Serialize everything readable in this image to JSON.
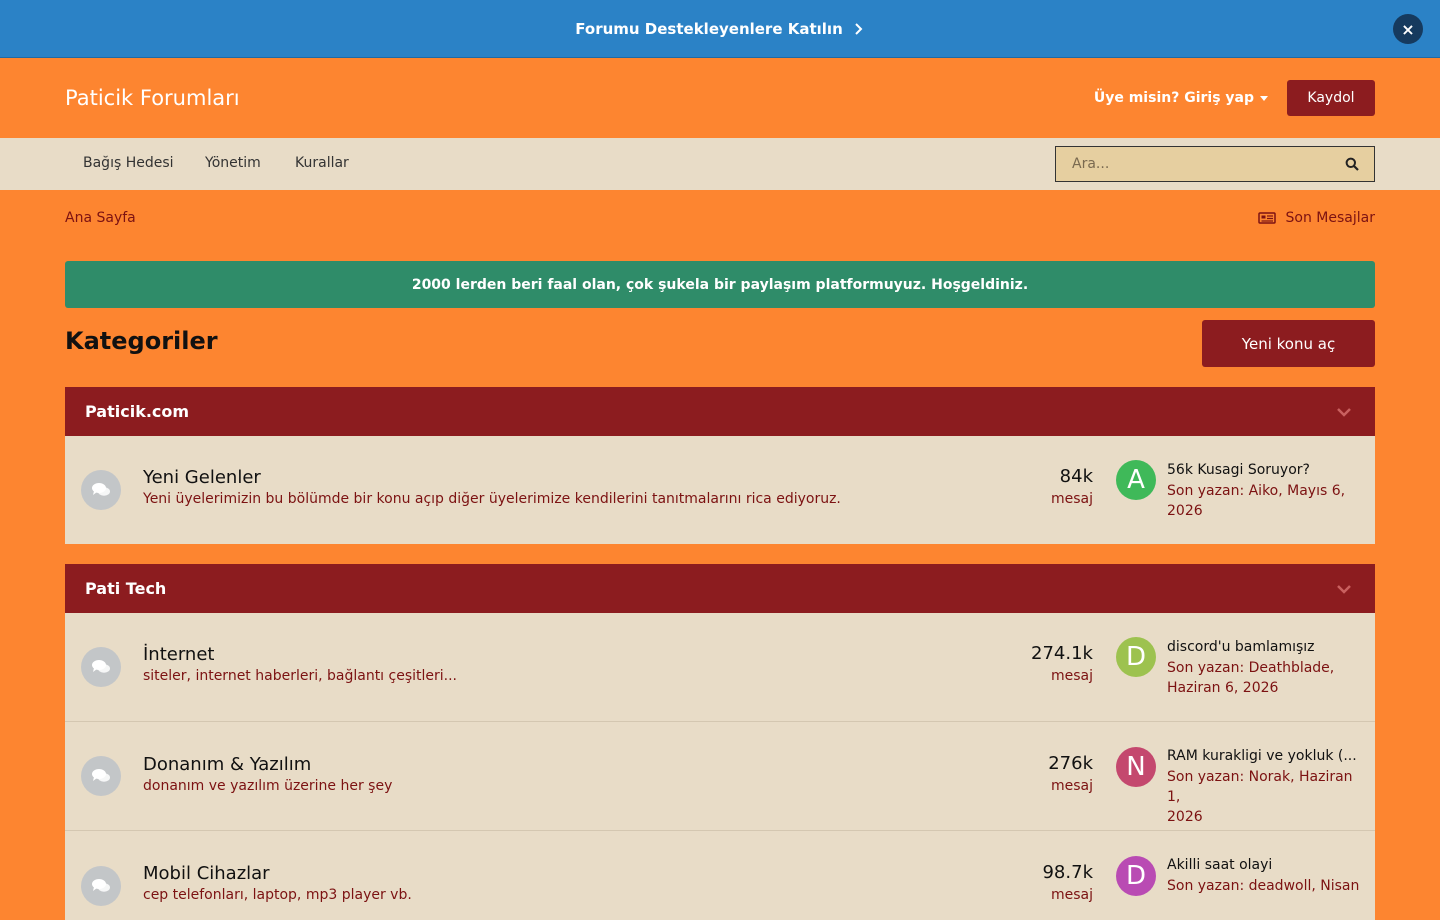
{
  "promo": {
    "text": "Forumu Destekleyenlere Katılın",
    "close": "×"
  },
  "header": {
    "site_title": "Paticik Forumları",
    "login": "Üye misin? Giriş yap",
    "register": "Kaydol"
  },
  "nav": {
    "items": [
      "Bağış Hedesi",
      "Yönetim",
      "Kurallar"
    ],
    "search_placeholder": "Ara..."
  },
  "breadcrumb": {
    "home": "Ana Sayfa",
    "recent": "Son Mesajlar"
  },
  "announcement": "2000 lerden beri faal olan, çok şukela bir paylaşım platformuyuz. Hoşgeldiniz.",
  "page": {
    "title": "Kategoriler",
    "new_topic": "Yeni konu aç"
  },
  "categories": [
    {
      "name": "Paticik.com",
      "forums": [
        {
          "title": "Yeni Gelenler",
          "desc": "Yeni üyelerimizin bu bölümde bir konu açıp diğer üyelerimize kendilerini tanıtmalarını rica ediyoruz.",
          "count": "84k",
          "count_label": "mesaj",
          "avatar": "A",
          "avatar_color": "#3fb959",
          "last_title": "56k Kusagi Soruyor?",
          "last_line1": "Son yazan: Aiko, Mayıs 6,",
          "last_line2": "2026"
        }
      ]
    },
    {
      "name": "Pati Tech",
      "forums": [
        {
          "title": "İnternet",
          "desc": "siteler, internet haberleri, bağlantı çeşitleri...",
          "count": "274.1k",
          "count_label": "mesaj",
          "avatar": "D",
          "avatar_color": "#9dc24f",
          "last_title": "discord'u bamlamışız",
          "last_line1": "Son yazan: Deathblade,",
          "last_line2": "Haziran 6, 2026"
        },
        {
          "title": "Donanım & Yazılım",
          "desc": "donanım ve yazılım üzerine her şey",
          "count": "276k",
          "count_label": "mesaj",
          "avatar": "N",
          "avatar_color": "#c4486e",
          "last_title": "RAM kurakligi ve yokluk (...",
          "last_line1": "Son yazan: Norak, Haziran 1,",
          "last_line2": "2026"
        },
        {
          "title": "Mobil Cihazlar",
          "desc": "cep telefonları, laptop, mp3 player vb.",
          "count": "98.7k",
          "count_label": "mesaj",
          "avatar": "D",
          "avatar_color": "#b94bb3",
          "last_title": "Akilli saat olayi",
          "last_line1": "Son yazan: deadwoll, Nisan",
          "last_line2": ""
        }
      ]
    }
  ]
}
